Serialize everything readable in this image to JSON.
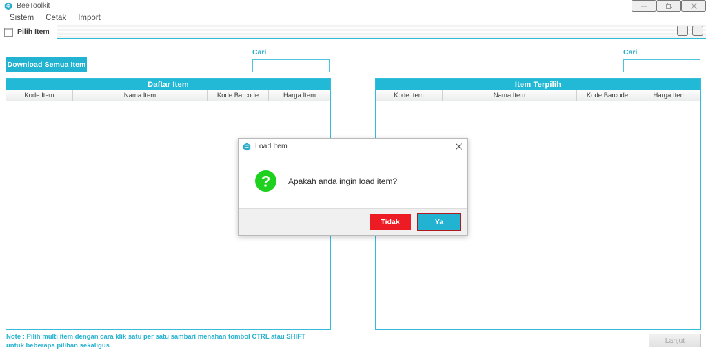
{
  "window": {
    "title": "BeeToolkit",
    "app_icon": "beetoolkit-hex-icon",
    "controls": {
      "minimize": "minimize-icon",
      "restore": "restore-icon",
      "close": "close-icon"
    }
  },
  "menubar": {
    "items": [
      {
        "label": "Sistem"
      },
      {
        "label": "Cetak"
      },
      {
        "label": "Import"
      }
    ]
  },
  "tabstrip": {
    "tab_label": "Pilih Item",
    "mdi_restore": "mdi-restore-icon",
    "mdi_close": "mdi-close-icon"
  },
  "toolbar": {
    "download_label": "Download Semua Item"
  },
  "search_left": {
    "label": "Cari",
    "value": "",
    "placeholder": ""
  },
  "search_right": {
    "label": "Cari",
    "value": "",
    "placeholder": ""
  },
  "left_panel": {
    "title": "Daftar Item",
    "columns": [
      "Kode Item",
      "Nama Item",
      "Kode Barcode",
      "Harga Item"
    ],
    "rows": []
  },
  "right_panel": {
    "title": "Item Terpilih",
    "columns": [
      "Kode Item",
      "Nama Item",
      "Kode Barcode",
      "Harga Item"
    ],
    "rows": []
  },
  "footer": {
    "note": "Note : Pilih multi item dengan cara klik satu per satu sambari menahan tombol CTRL atau SHIFT untuk beberapa pilihan sekaligus",
    "lanjut_label": "Lanjut"
  },
  "dialog": {
    "title": "Load Item",
    "title_icon": "beetoolkit-hex-icon",
    "close_icon": "close-icon",
    "question_icon": "green-question-icon",
    "message": "Apakah anda ingin load item?",
    "no_label": "Tidak",
    "yes_label": "Ya"
  },
  "colors": {
    "accent_teal": "#22b3d2",
    "panel_border": "#34bcd8",
    "danger_red": "#ed1c24",
    "focus_ring_red": "#b01a1f",
    "question_green": "#22cc22"
  }
}
